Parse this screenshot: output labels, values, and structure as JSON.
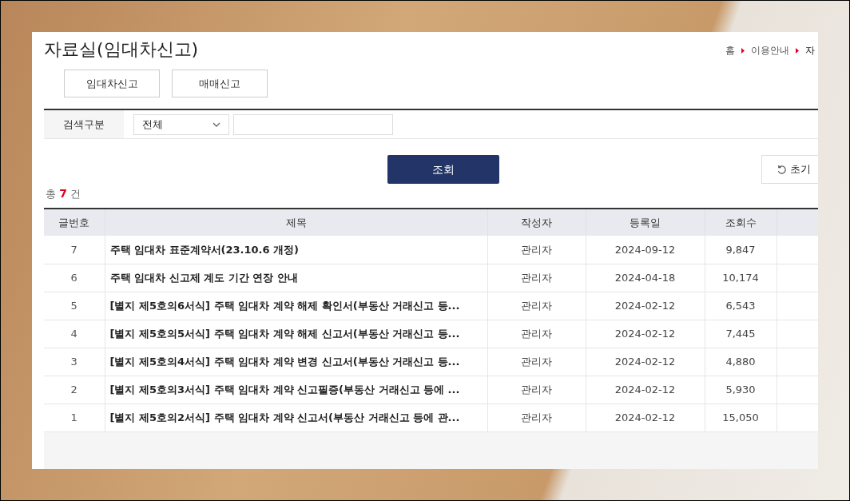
{
  "page": {
    "title": "자료실(임대차신고)",
    "breadcrumb": [
      {
        "label": "홈",
        "current": false
      },
      {
        "label": "이용안내",
        "current": false
      },
      {
        "label": "자",
        "current": true
      }
    ],
    "tabs": [
      {
        "label": "임대차신고"
      },
      {
        "label": "매매신고"
      }
    ]
  },
  "search": {
    "label": "검색구분",
    "select": {
      "value": "전체"
    },
    "search_button": "조회",
    "reset_button": "초기"
  },
  "total": {
    "prefix": "총",
    "count": "7",
    "suffix": "건"
  },
  "table": {
    "columns": [
      "글번호",
      "제목",
      "작성자",
      "등록일",
      "조회수"
    ],
    "rows": [
      {
        "no": "7",
        "title": "주택 임대차 표준계약서(23.10.6 개정)",
        "author": "관리자",
        "date": "2024-09-12",
        "views": "9,847"
      },
      {
        "no": "6",
        "title": "주택 임대차 신고제 계도 기간 연장 안내",
        "author": "관리자",
        "date": "2024-04-18",
        "views": "10,174"
      },
      {
        "no": "5",
        "title": "[별지 제5호의6서식] 주택 임대차 계약 해제 확인서(부동산 거래신고 등...",
        "author": "관리자",
        "date": "2024-02-12",
        "views": "6,543"
      },
      {
        "no": "4",
        "title": "[별지 제5호의5서식] 주택 임대차 계약 해제 신고서(부동산 거래신고 등...",
        "author": "관리자",
        "date": "2024-02-12",
        "views": "7,445"
      },
      {
        "no": "3",
        "title": "[별지 제5호의4서식] 주택 임대차 계약 변경 신고서(부동산 거래신고 등...",
        "author": "관리자",
        "date": "2024-02-12",
        "views": "4,880"
      },
      {
        "no": "2",
        "title": "[별지 제5호의3서식] 주택 임대차 계약 신고필증(부동산 거래신고 등에 ...",
        "author": "관리자",
        "date": "2024-02-12",
        "views": "5,930"
      },
      {
        "no": "1",
        "title": "[별지 제5호의2서식] 주택 임대차 계약 신고서(부동산 거래신고 등에 관...",
        "author": "관리자",
        "date": "2024-02-12",
        "views": "15,050"
      }
    ]
  }
}
